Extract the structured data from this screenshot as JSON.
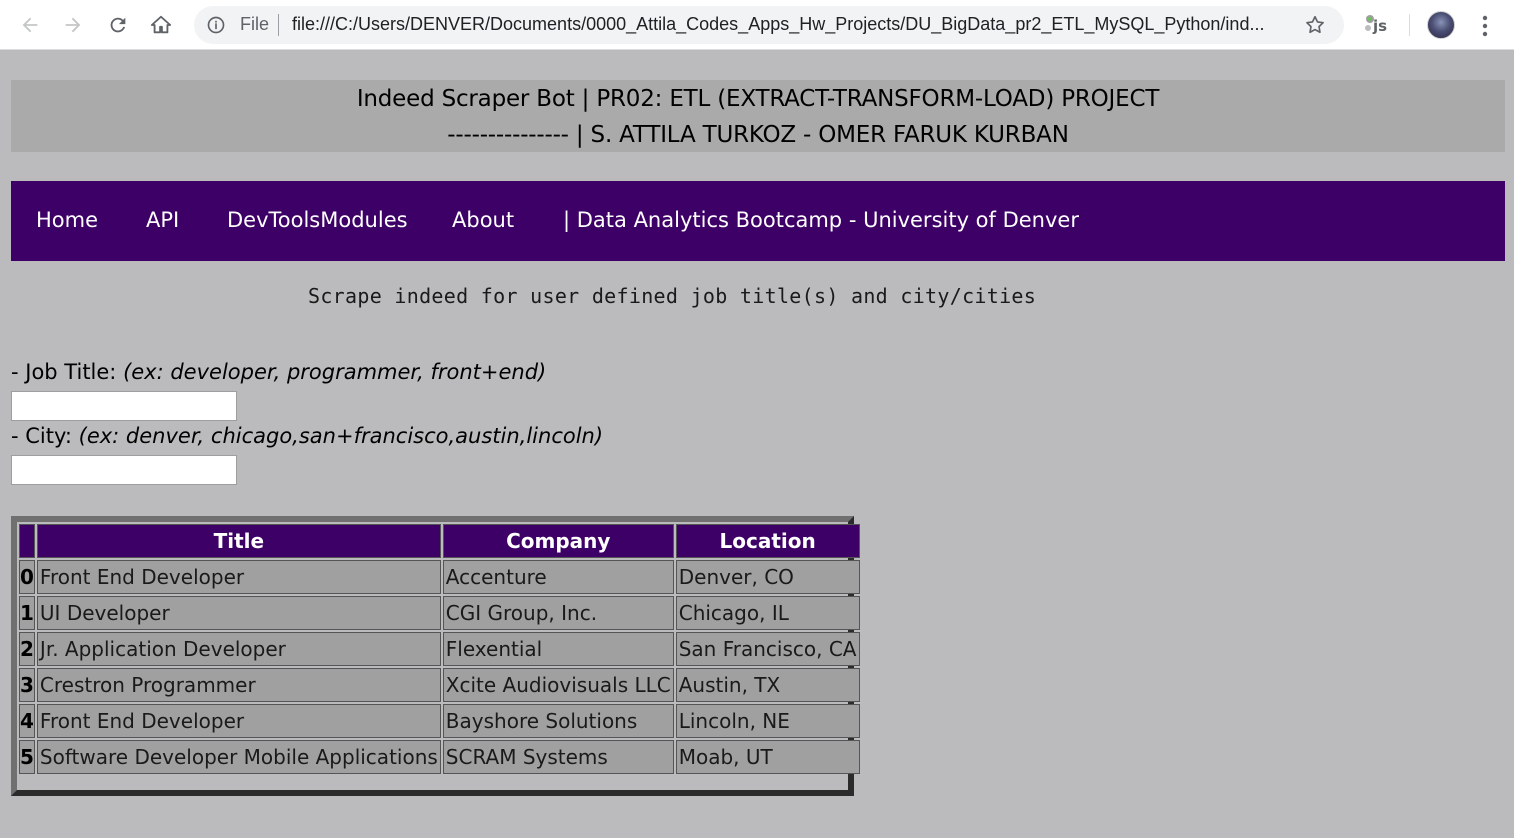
{
  "browser": {
    "omnibox_scheme": "File",
    "url": "file:///C:/Users/DENVER/Documents/0000_Attila_Codes_Apps_Hw_Projects/DU_BigData_pr2_ETL_MySQL_Python/ind...",
    "extension_label": "js"
  },
  "header": {
    "line1": "Indeed Scraper Bot | PR02: ETL (EXTRACT-TRANSFORM-LOAD) PROJECT",
    "line2": "--------------- | S. ATTILA TURKOZ - OMER FARUK KURBAN"
  },
  "nav": {
    "home": "Home",
    "api": "API",
    "devtools": "DevToolsModules",
    "about": "About",
    "bootcamp": "| Data Analytics Bootcamp - University of Denver"
  },
  "tagline": "Scrape indeed for user defined job title(s) and city/cities",
  "form": {
    "job_label": "- Job Title: ",
    "job_hint": "(ex: developer, programmer, front+end)",
    "job_value": "",
    "city_label": "- City: ",
    "city_hint": "(ex: denver, chicago,san+francisco,austin,lincoln)",
    "city_value": ""
  },
  "table": {
    "headers": [
      "",
      "Title",
      "Company",
      "Location"
    ],
    "rows": [
      [
        "0",
        "Front End Developer",
        "Accenture",
        "Denver, CO"
      ],
      [
        "1",
        "UI Developer",
        "CGI Group, Inc.",
        "Chicago, IL"
      ],
      [
        "2",
        "Jr. Application Developer",
        "Flexential",
        "San Francisco, CA"
      ],
      [
        "3",
        "Crestron Programmer",
        "Xcite Audiovisuals LLC",
        "Austin, TX"
      ],
      [
        "4",
        "Front End Developer",
        "Bayshore Solutions",
        "Lincoln, NE"
      ],
      [
        "5",
        "Software Developer Mobile Applications",
        "SCRAM Systems",
        "Moab, UT"
      ]
    ]
  },
  "colors": {
    "nav_bg": "#3d0066",
    "page_bg": "#bbbbbd",
    "header_bg": "#aaaaaa",
    "cell_bg": "#a0a0a0"
  }
}
